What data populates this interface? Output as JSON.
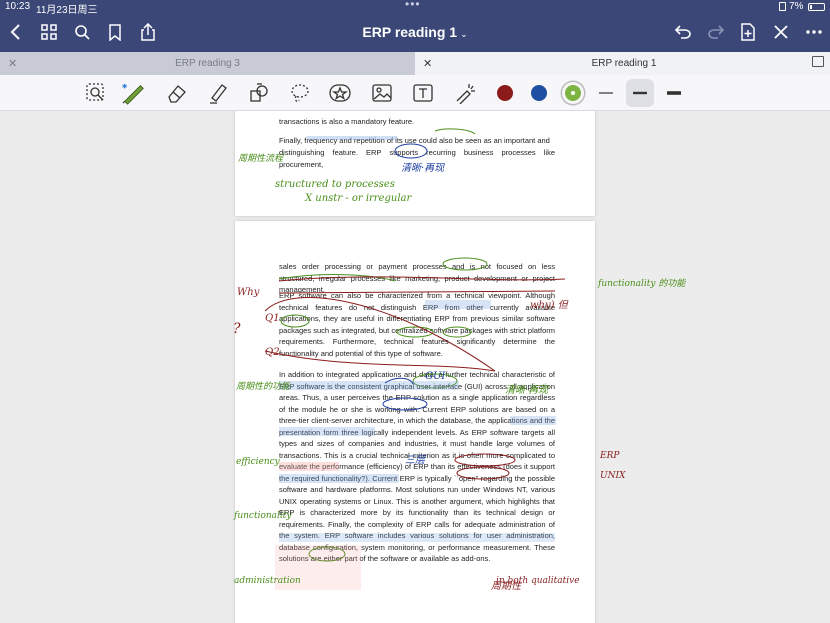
{
  "status": {
    "time": "10:23",
    "date": "11月23日周三",
    "battery": "7%"
  },
  "title_bar": {
    "title": "ERP reading 1",
    "colors": {
      "bar": "#3b4777"
    }
  },
  "tabs": [
    {
      "label": "ERP reading 3",
      "active": false
    },
    {
      "label": "ERP reading 1",
      "active": true
    }
  ],
  "toolbar": {
    "tools": [
      "zoom-lasso-icon",
      "pen-icon",
      "eraser-icon",
      "highlighter-icon",
      "shapes-icon",
      "lasso-icon",
      "sticker-icon",
      "image-icon",
      "text-box-icon",
      "laser-pointer-icon"
    ],
    "colors": [
      "#8b1a1a",
      "#1f4fa3",
      "#7cb342"
    ],
    "selected_color": "#7cb342",
    "stroke_sizes": [
      "thin",
      "medium",
      "thick"
    ],
    "selected_stroke": "medium"
  },
  "page1": {
    "lines": [
      "transactions is also a mandatory feature.",
      "Finally, frequency and repetition of its use could also be seen as an important and",
      "distinguishing feature. ERP supports recurring business processes like procurement,"
    ]
  },
  "page2": {
    "para1": "sales order processing or payment processes and is not focused on less structured, irregular processes like marketing, product development or project management.",
    "para2": "ERP software can also be characterized from a technical viewpoint. Although technical features do not distinguish ERP from other currently available applications, they are useful in differentiating ERP from previous similar software packages such as integrated, but centralized software packages with strict platform requirements. Furthermore, technical features significantly determine the functionality and potential of this type of software.",
    "para3": "In addition to integrated applications and data, a further technical characteristic of ERP software is the consistent graphical user interface (GUI) across all application areas. Thus, a user perceives the ERP solution as a single application regardless of the module he or she is working with. Current ERP solutions are based on a three-tier client-server architecture, in which the database, the applications and the presentation form three logically independent levels. As ERP software targets all types and sizes of companies and industries, it must handle large volumes of transactions. This is a crucial technical criterion as it is often more complicated to evaluate the performance (efficiency) of ERP than its effectiveness (does it support the required functionality?). Current ERP is typically ``open'' regarding the possible software and hardware platforms. Most solutions run under Windows NT, various UNIX operating systems or Linux. This is another argument, which highlights that ERP is characterized more by its functionality than its technical design or requirements. Finally, the complexity of ERP calls for adequate administration of the system. ERP software includes various solutions for user administration, database configuration, system monitoring, or performance measurement. These solutions are either part of the software or available as add-ons."
  },
  "annotations": {
    "green": [
      "周期性流程",
      "structured to processes",
      "X unstr - or irregular",
      "清晰·再现",
      "周期性的功能",
      "functionality 的功能",
      "efficiency",
      "functionality",
      "administration",
      "in both qualitative"
    ],
    "red": [
      "Why",
      "Q1",
      "Q2",
      "?",
      "why) 但",
      "周期性",
      "ERP",
      "UNIX"
    ],
    "blue": [
      "清晰·再现",
      "GUI",
      "三层"
    ]
  }
}
